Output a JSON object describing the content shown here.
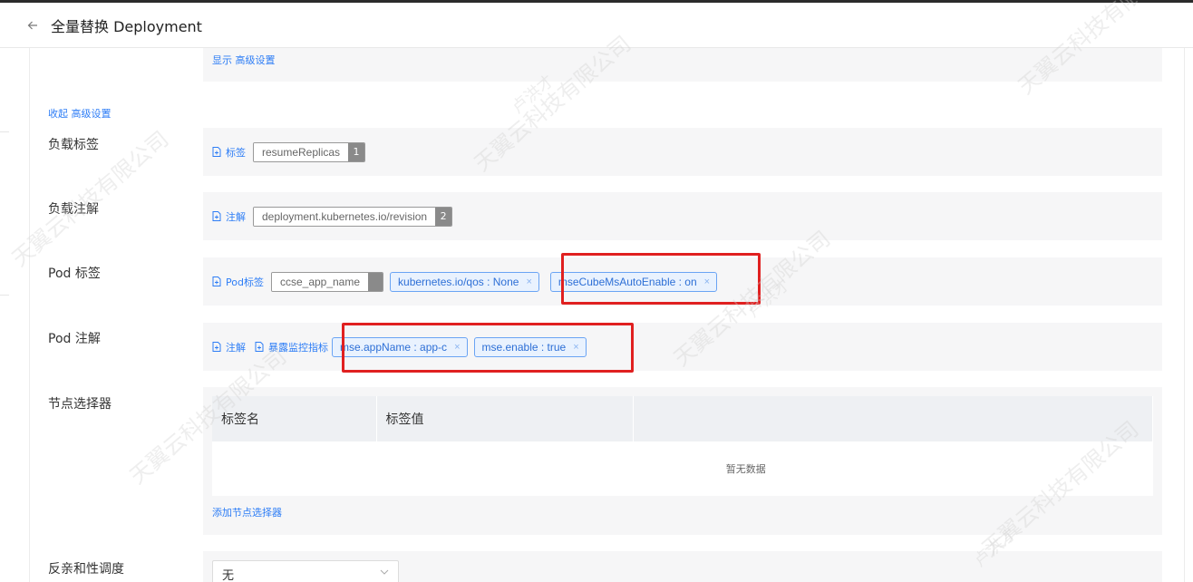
{
  "header": {
    "title": "全量替换 Deployment"
  },
  "advanced": {
    "show_label": "显示 高级设置",
    "collapse_label": "收起 高级设置"
  },
  "rows": {
    "workload_labels": {
      "label": "负载标签",
      "action": "标签",
      "tag": {
        "text": "resumeReplicas",
        "count": "1"
      }
    },
    "workload_annotations": {
      "label": "负载注解",
      "action": "注解",
      "tag": {
        "text": "deployment.kubernetes.io/revision",
        "count": "2"
      }
    },
    "pod_labels": {
      "label": "Pod 标签",
      "action": "Pod标签",
      "tag": {
        "text": "ccse_app_name"
      },
      "chips": [
        "kubernetes.io/qos : None",
        "mseCubeMsAutoEnable : on"
      ]
    },
    "pod_annotations": {
      "label": "Pod 注解",
      "action_annotation": "注解",
      "action_expose": "暴露监控指标",
      "chips": [
        "mse.appName : app-c",
        "mse.enable : true"
      ]
    },
    "node_selector": {
      "label": "节点选择器",
      "columns": [
        "标签名",
        "标签值"
      ],
      "empty_text": "暂无数据",
      "add_link": "添加节点选择器"
    },
    "anti_affinity": {
      "label": "反亲和性调度",
      "selected": "无"
    }
  },
  "chip_close": "×",
  "watermark": {
    "company": "天翼云科技有限公司",
    "user": "卢洪才"
  },
  "colors": {
    "highlight": "#e02020",
    "link": "#2d7df6",
    "panel": "#f6f6f7"
  }
}
